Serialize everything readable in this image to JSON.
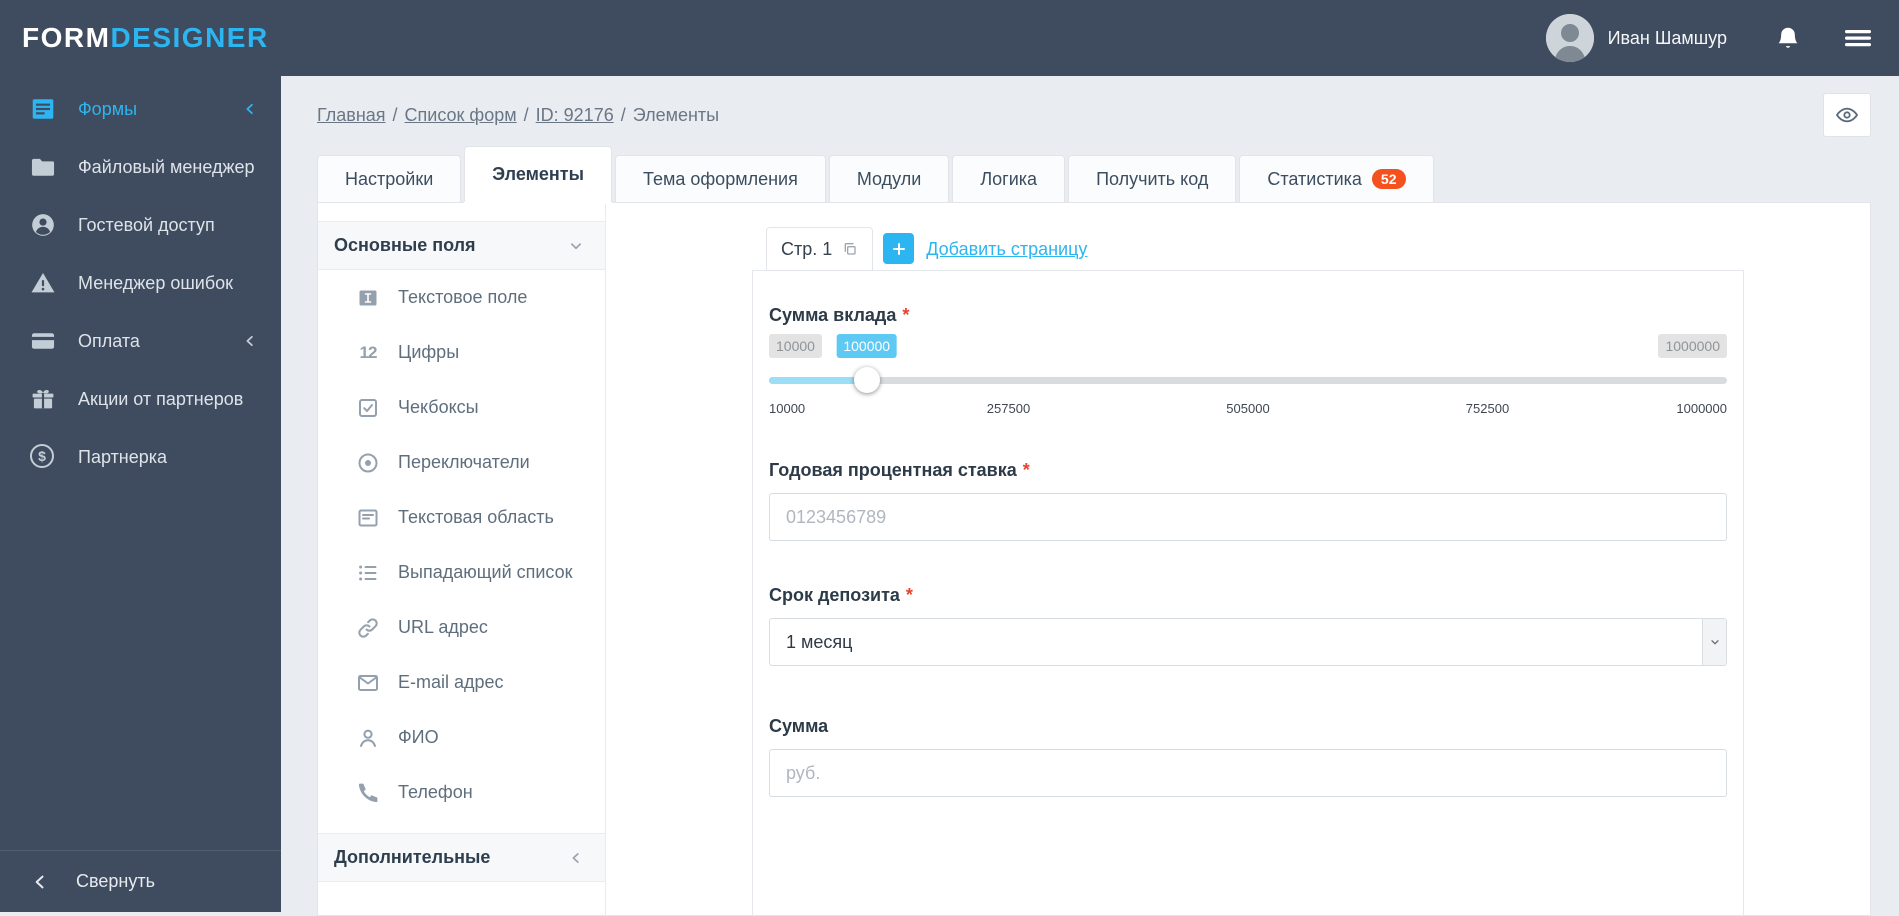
{
  "colors": {
    "chrome_bg": "#3f4c5f",
    "accent": "#2cb5f0",
    "stat_badge": "#f4511e",
    "slider_fill": "#9bdef6",
    "required": "#e8412c"
  },
  "icon_glyphs": {
    "numbers": "12",
    "currency": "$"
  },
  "topbar": {
    "logo_primary": "FORM",
    "logo_accent": "DESIGNER",
    "user_name": "Иван Шамшур"
  },
  "sidebar": {
    "items": [
      {
        "label": "Формы"
      },
      {
        "label": "Файловый менеджер"
      },
      {
        "label": "Гостевой доступ"
      },
      {
        "label": "Менеджер ошибок"
      },
      {
        "label": "Оплата"
      },
      {
        "label": "Акции от партнеров"
      },
      {
        "label": "Партнерка"
      }
    ],
    "collapse_label": "Свернуть"
  },
  "breadcrumb": {
    "separator": "/",
    "items": [
      "Главная",
      "Список форм",
      "ID: 92176",
      "Элементы"
    ]
  },
  "tabs": [
    {
      "label": "Настройки"
    },
    {
      "label": "Элементы"
    },
    {
      "label": "Тема оформления"
    },
    {
      "label": "Модули"
    },
    {
      "label": "Логика"
    },
    {
      "label": "Получить код"
    },
    {
      "label": "Статистика",
      "badge": "52"
    }
  ],
  "elements_panel": {
    "group_basic": "Основные поля",
    "group_additional": "Дополнительные",
    "items": [
      "Текстовое поле",
      "Цифры",
      "Чекбоксы",
      "Переключатели",
      "Текстовая область",
      "Выпадающий список",
      "URL адрес",
      "E-mail адрес",
      "ФИО",
      "Телефон"
    ]
  },
  "builder": {
    "page_tab": "Стр. 1",
    "add_page": "Добавить страницу",
    "required_mark": "*",
    "deposit": {
      "label": "Сумма вклада",
      "min_badge": "10000",
      "current_badge": "100000",
      "max_badge": "1000000",
      "slider_position_pct": 10.2,
      "scale": [
        "10000",
        "257500",
        "505000",
        "752500",
        "1000000"
      ]
    },
    "rate": {
      "label": "Годовая процентная ставка",
      "placeholder": "0123456789"
    },
    "term": {
      "label": "Срок депозита",
      "value": "1 месяц"
    },
    "amount": {
      "label": "Сумма",
      "placeholder": "руб."
    }
  }
}
